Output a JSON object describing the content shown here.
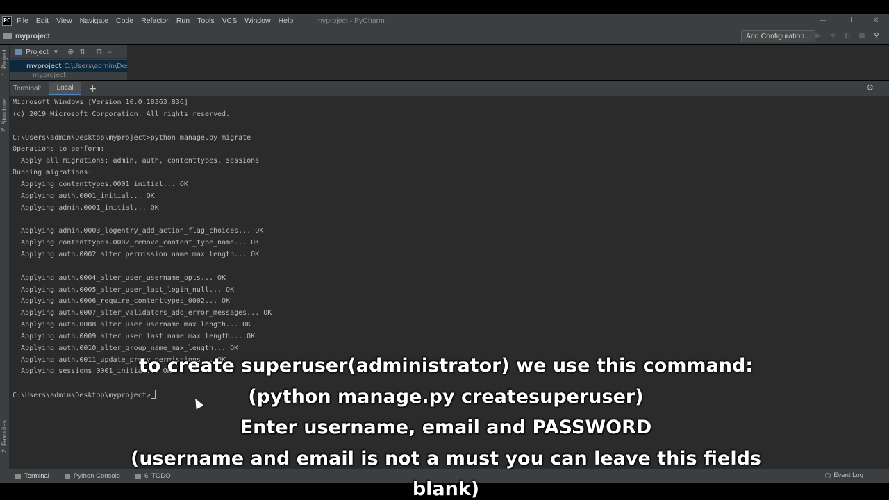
{
  "window": {
    "app_icon": "PC",
    "title": "myproject - PyCharm",
    "menu": [
      "File",
      "Edit",
      "View",
      "Navigate",
      "Code",
      "Refactor",
      "Run",
      "Tools",
      "VCS",
      "Window",
      "Help"
    ],
    "controls": {
      "minimize": "—",
      "restore": "❐",
      "close": "✕"
    }
  },
  "navbar": {
    "project": "myproject",
    "add_configuration": "Add Configuration...",
    "run_icons": [
      "run-icon",
      "debug-icon",
      "coverage-icon",
      "stop-icon",
      "search-everywhere-icon"
    ]
  },
  "left_strip": {
    "project_tab": "1: Project",
    "structure_tab": "Z: Structure",
    "favorites_tab": "2: Favorites"
  },
  "project_panel": {
    "selector": "Project",
    "root_name": "myproject",
    "root_path": "C:\\Users\\admin\\Des",
    "child": "myproject"
  },
  "terminal_panel": {
    "label": "Terminal:",
    "tab": "Local",
    "add": "+",
    "lines": [
      "Microsoft Windows [Version 10.0.18363.836]",
      "(c) 2019 Microsoft Corporation. All rights reserved.",
      "",
      "C:\\Users\\admin\\Desktop\\myproject>python manage.py migrate",
      "Operations to perform:",
      "  Apply all migrations: admin, auth, contenttypes, sessions",
      "Running migrations:",
      "  Applying contenttypes.0001_initial... OK",
      "  Applying auth.0001_initial... OK",
      "  Applying admin.0001_initial... OK",
      "",
      "  Applying admin.0003_logentry_add_action_flag_choices... OK",
      "  Applying contenttypes.0002_remove_content_type_name... OK",
      "  Applying auth.0002_alter_permission_name_max_length... OK",
      "",
      "  Applying auth.0004_alter_user_username_opts... OK",
      "  Applying auth.0005_alter_user_last_login_null... OK",
      "  Applying auth.0006_require_contenttypes_0002... OK",
      "  Applying auth.0007_alter_validators_add_error_messages... OK",
      "  Applying auth.0008_alter_user_username_max_length... OK",
      "  Applying auth.0009_alter_user_last_name_max_length... OK",
      "  Applying auth.0010_alter_group_name_max_length... OK",
      "  Applying auth.0011_update_proxy_permissions... OK",
      "  Applying sessions.0001_initial... OK",
      "",
      "C:\\Users\\admin\\Desktop\\myproject>"
    ]
  },
  "statusbar": {
    "terminal": "Terminal",
    "python_console": "Python Console",
    "todo": "6: TODO",
    "event_log": "Event Log"
  },
  "subtitles": [
    "to create superuser(administrator) we use this command:",
    "(python manage.py createsuperuser)",
    "Enter username, email and PASSWORD",
    "(username and email is not a must you can leave this fields blank)"
  ]
}
